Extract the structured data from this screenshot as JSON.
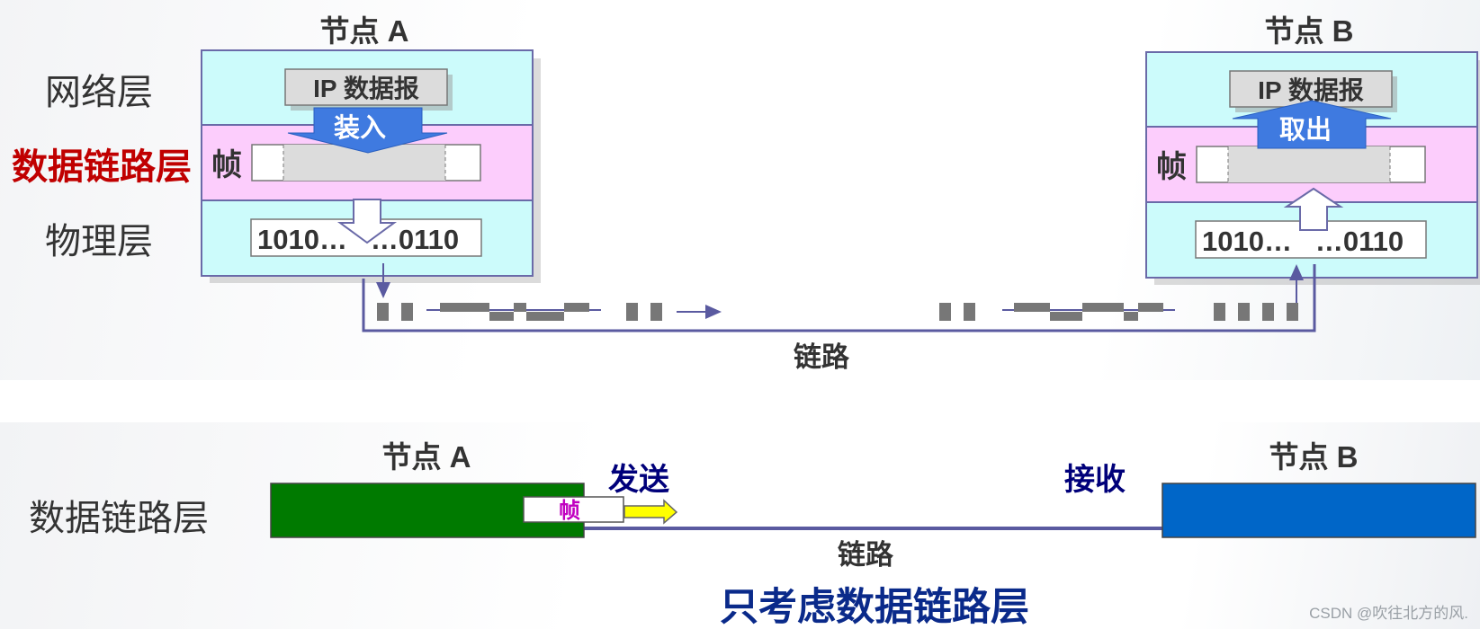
{
  "top": {
    "node_a_title": "节点 A",
    "node_b_title": "节点 B",
    "layers": {
      "network": "网络层",
      "data_link": "数据链路层",
      "physical": "物理层"
    },
    "ip_datagram": "IP 数据报",
    "encapsulate": "装入",
    "extract": "取出",
    "frame": "帧",
    "bits_start": "1010…",
    "bits_end": "…0110",
    "link": "链路"
  },
  "bottom": {
    "layer": "数据链路层",
    "node_a_title": "节点  A",
    "node_b_title": "节点  B",
    "send": "发送",
    "receive": "接收",
    "frame": "帧",
    "link": "链路",
    "caption": "只考虑数据链路层"
  },
  "watermark": "CSDN @吹往北方的风.",
  "colors": {
    "network_layer": "#ccfbfb",
    "data_link_layer": "#fccdfc",
    "physical_layer": "#ccfbfb",
    "arrow_blue": "#3f7ae0",
    "data_link_label": "#c00000",
    "node_a_block": "#007a00",
    "node_b_block": "#0066c8",
    "frame_label": "#c000c0",
    "send_receive_label": "#00007a"
  }
}
